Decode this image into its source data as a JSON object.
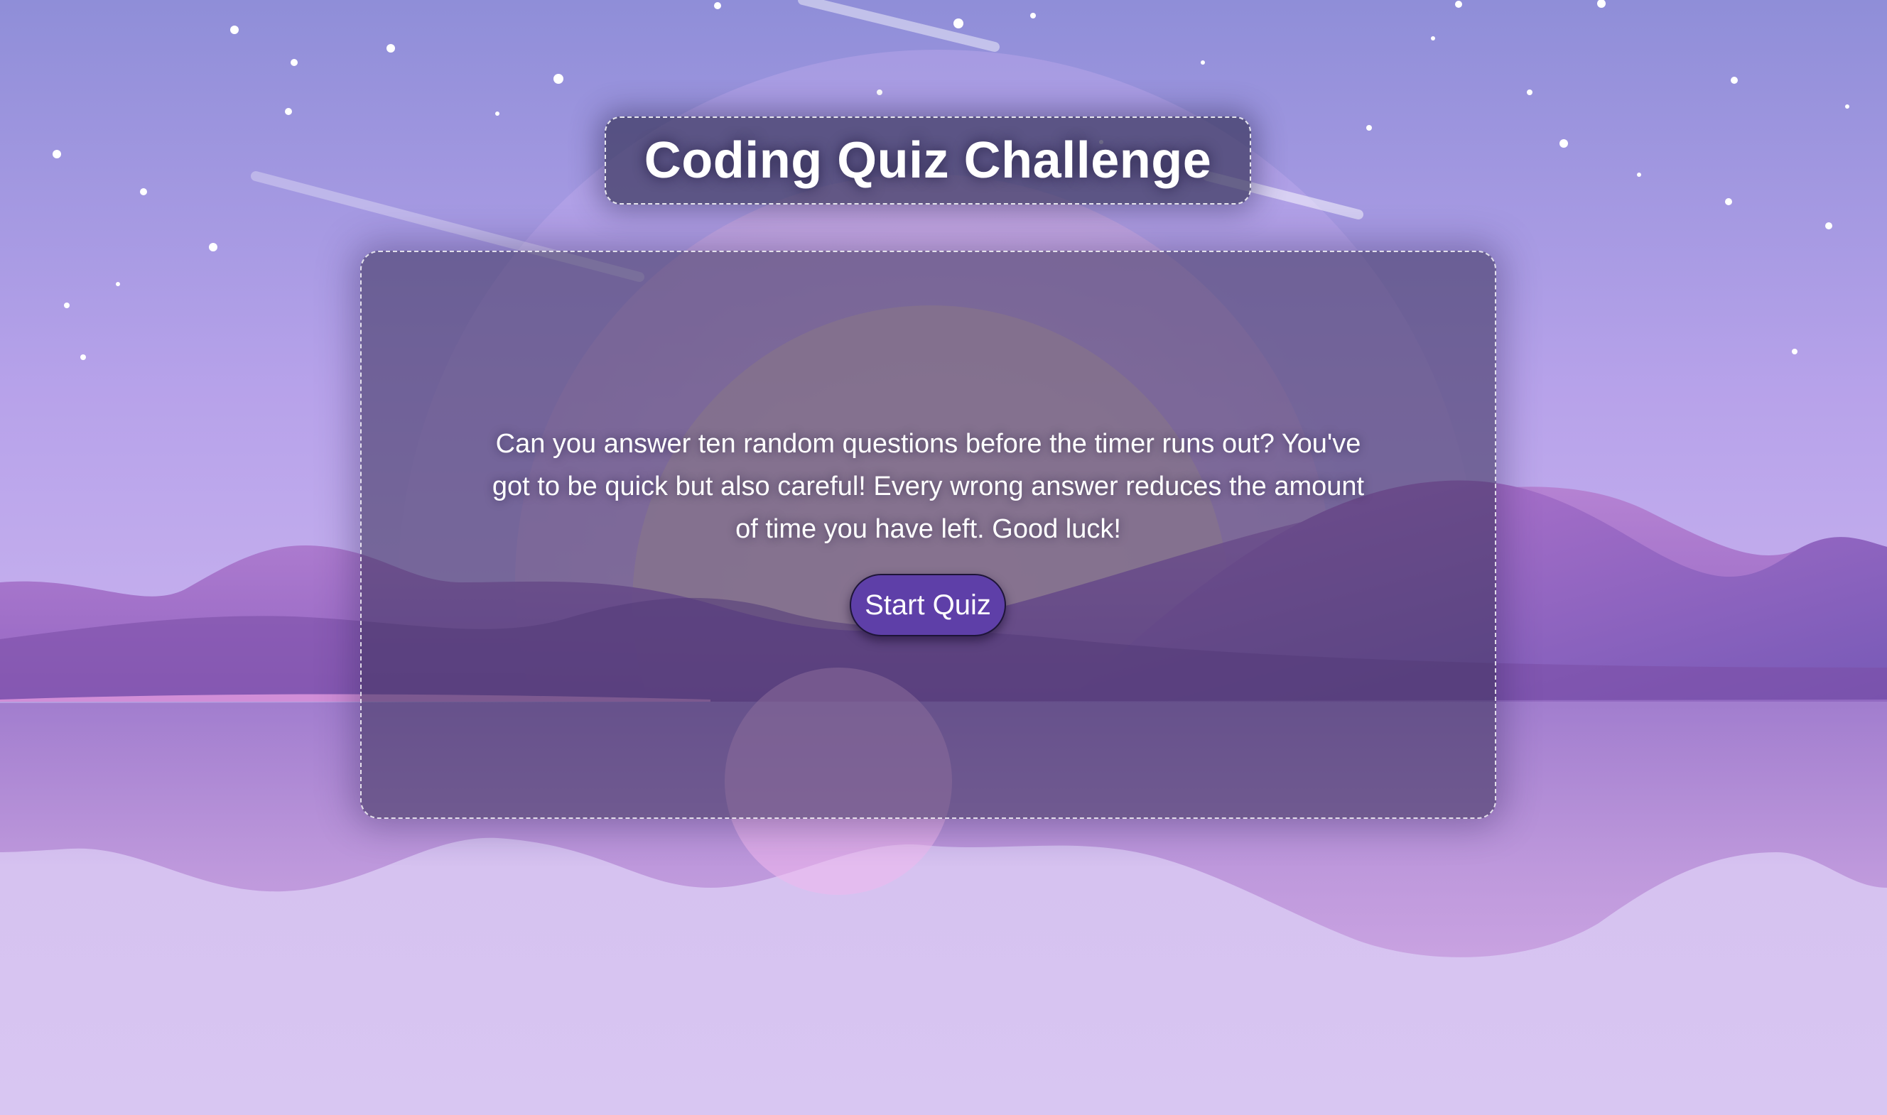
{
  "header": {
    "title": "Coding Quiz Challenge"
  },
  "intro": {
    "text": "Can you answer ten random questions before the timer runs out? You've got to be quick but also careful! Every wrong answer reduces the amount of time you have left. Good luck!",
    "start_label": "Start Quiz"
  },
  "colors": {
    "sky": "#9a92d8",
    "card_overlay": "#372d55",
    "button": "#5e3fa8",
    "mountain": "#8a55b8",
    "water": "#d8c4f0"
  }
}
